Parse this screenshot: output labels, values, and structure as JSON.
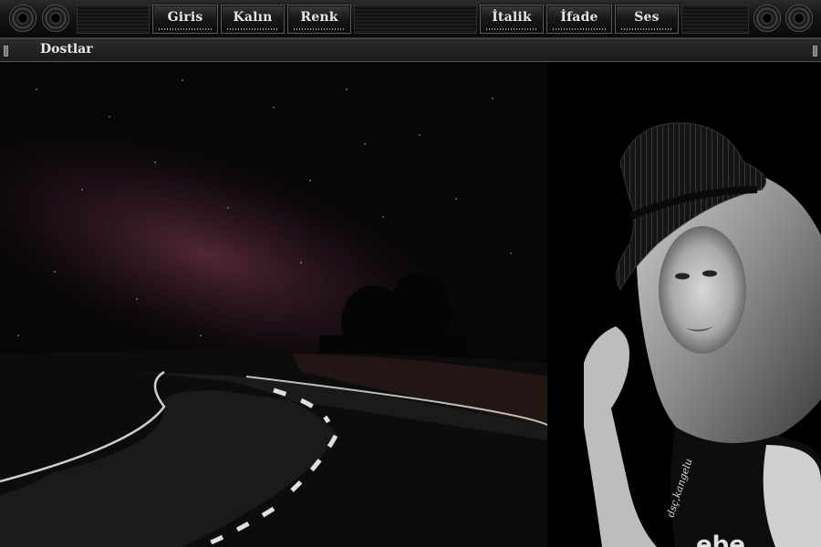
{
  "toolbar": {
    "buttons": [
      {
        "label": "Giris"
      },
      {
        "label": "Kalın"
      },
      {
        "label": "Renk"
      },
      {
        "label": "İtalik"
      },
      {
        "label": "İfade"
      },
      {
        "label": "Ses"
      }
    ]
  },
  "subbar": {
    "title": "Dostlar"
  },
  "background": {
    "signature": "dsç,kangelu",
    "shirt_text": "ebe"
  },
  "colors": {
    "toolbar_bg": "#141414",
    "button_text": "#e6e6e6",
    "sky_glow": "#5a2a3a"
  }
}
